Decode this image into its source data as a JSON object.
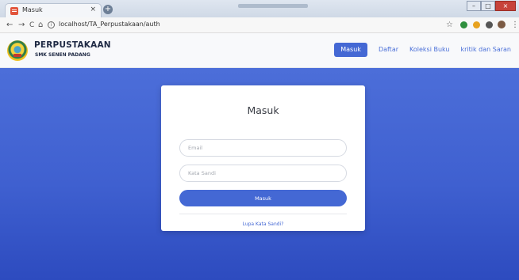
{
  "browser": {
    "tab_title": "Masuk",
    "tab_close": "×",
    "new_tab": "+",
    "url": "localhost/TA_Perpustakaan/auth",
    "back": "←",
    "forward": "→",
    "reload": "C",
    "home": "⌂",
    "info": "i",
    "star": "☆",
    "menu": "⋮",
    "win_min": "–",
    "win_max": "□",
    "win_close": "×"
  },
  "navbar": {
    "brand_name": "PERPUSTAKAAN",
    "brand_subtitle": "SMK SENEN PADANG",
    "menu": [
      {
        "label": "Masuk",
        "active": true
      },
      {
        "label": "Daftar",
        "active": false
      },
      {
        "label": "Koleksi Buku",
        "active": false
      },
      {
        "label": "kritik dan Saran",
        "active": false
      }
    ]
  },
  "login": {
    "title": "Masuk",
    "email_placeholder": "Email",
    "email_value": "",
    "password_placeholder": "Kata Sandi",
    "password_value": "",
    "submit_label": "Masuk",
    "forgot_label": "Lupa Kata Sandi?"
  },
  "colors": {
    "primary": "#4468d4",
    "background_top": "#4c6ed9",
    "background_bottom": "#2d4bbf",
    "navbar_bg": "#f8f9fb"
  }
}
